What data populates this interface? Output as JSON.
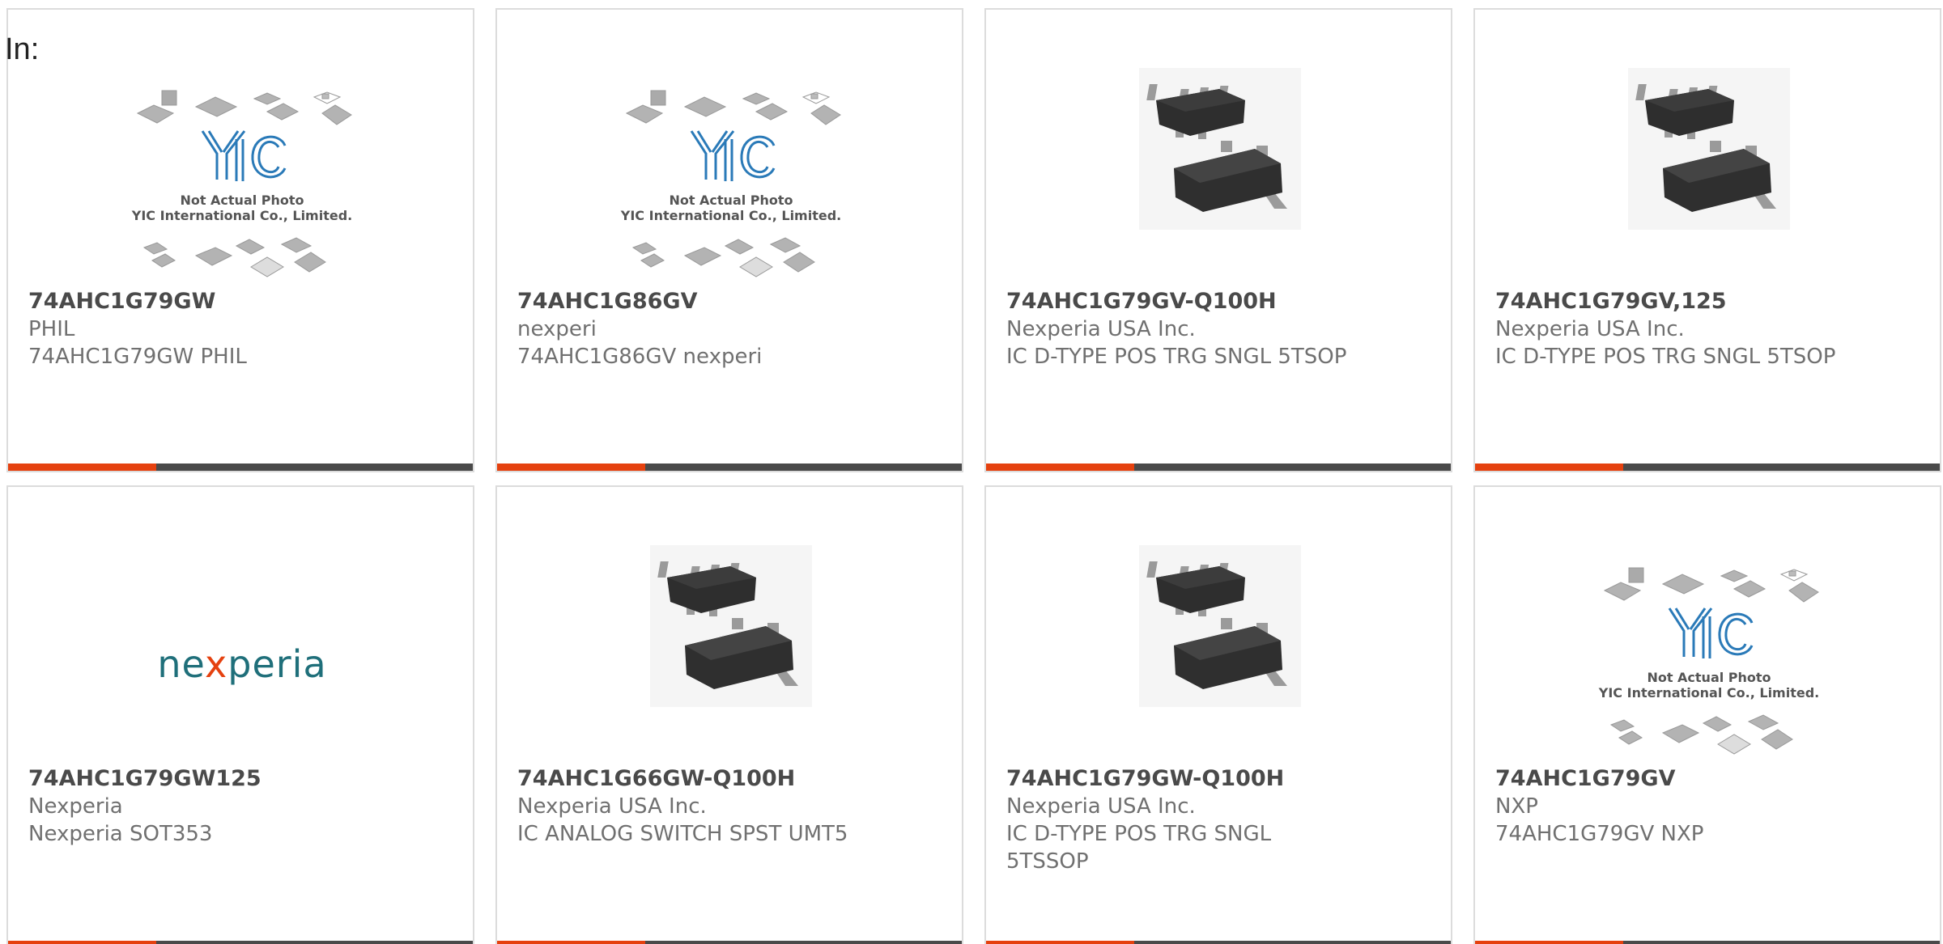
{
  "header": {
    "in_label": "In:"
  },
  "placeholder": {
    "logo_text": "YIC",
    "line1": "Not Actual Photo",
    "line2": "YIC International Co., Limited."
  },
  "brand_logo": {
    "text_a": "ne",
    "text_x": "x",
    "text_b": "peria",
    "color_text": "#1f6f7a",
    "color_x": "#e5410f"
  },
  "colors": {
    "accent": "#e5410f",
    "bar": "#4a4a4a",
    "border": "#dcdcdc"
  },
  "cards": [
    {
      "part": "74AHC1G79GW",
      "manufacturer": "PHIL",
      "description": "74AHC1G79GW PHIL",
      "image": "placeholder"
    },
    {
      "part": "74AHC1G86GV",
      "manufacturer": "nexperi",
      "description": "74AHC1G86GV nexperi",
      "image": "placeholder"
    },
    {
      "part": "74AHC1G79GV-Q100H",
      "manufacturer": "Nexperia USA Inc.",
      "description": "IC D-TYPE POS TRG SNGL 5TSOP",
      "image": "chip"
    },
    {
      "part": "74AHC1G79GV,125",
      "manufacturer": "Nexperia USA Inc.",
      "description": "IC D-TYPE POS TRG SNGL 5TSOP",
      "image": "chip"
    },
    {
      "part": "74AHC1G79GW125",
      "manufacturer": "Nexperia",
      "description": "Nexperia SOT353",
      "image": "brand"
    },
    {
      "part": "74AHC1G66GW-Q100H",
      "manufacturer": "Nexperia USA Inc.",
      "description": "IC ANALOG SWITCH SPST UMT5",
      "image": "chip"
    },
    {
      "part": "74AHC1G79GW-Q100H",
      "manufacturer": "Nexperia USA Inc.",
      "description": "IC D-TYPE POS TRG SNGL 5TSSOP",
      "image": "chip"
    },
    {
      "part": "74AHC1G79GV",
      "manufacturer": "NXP",
      "description": "74AHC1G79GV NXP",
      "image": "placeholder"
    }
  ]
}
